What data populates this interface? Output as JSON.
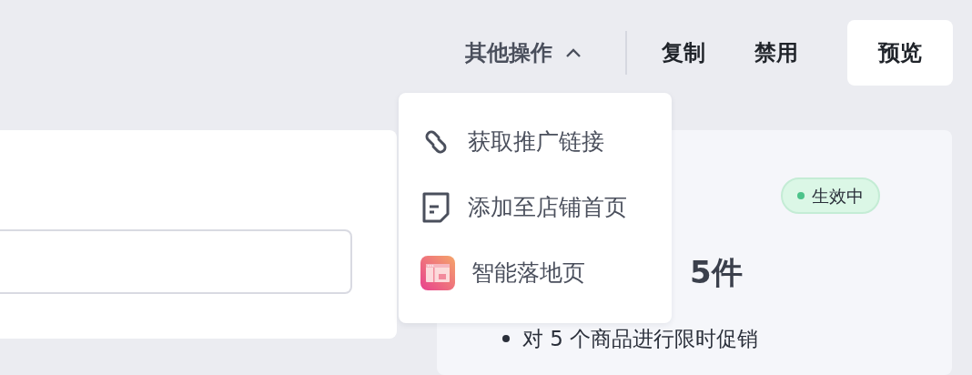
{
  "toolbar": {
    "more_actions": {
      "label": "其他操作",
      "expanded": true
    },
    "buttons": [
      {
        "label": "复制",
        "kind": "text"
      },
      {
        "label": "禁用",
        "kind": "text"
      },
      {
        "label": "预览",
        "kind": "filled"
      }
    ]
  },
  "dropdown": {
    "items": [
      {
        "label": "获取推广链接",
        "kind": "link"
      },
      {
        "label": "添加至店铺首页",
        "kind": "page"
      },
      {
        "label": "智能落地页",
        "kind": "ai"
      }
    ]
  },
  "right_card": {
    "status": {
      "label": "生效中",
      "color": "#4cc38a"
    },
    "title": "5件",
    "bullets": [
      "对 5 个商品进行限时促销"
    ]
  }
}
